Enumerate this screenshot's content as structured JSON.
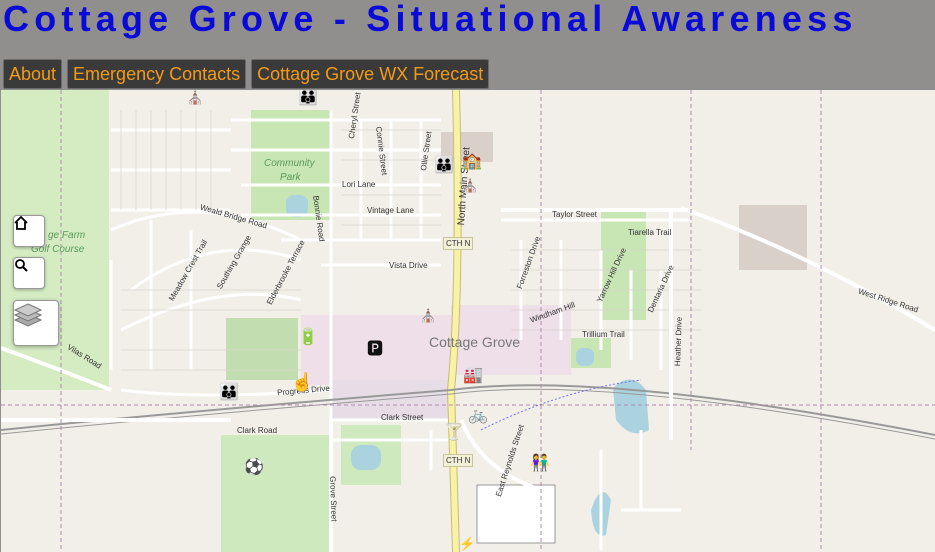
{
  "header": {
    "title": "Cottage Grove - Situational Awareness",
    "nav": [
      "About",
      "Emergency Contacts",
      "Cottage Grove WX Forecast"
    ]
  },
  "map": {
    "town_label": "Cottage Grove",
    "park_labels": [
      "Community",
      "Park",
      "ge Farm",
      "Golf Course"
    ],
    "streets": [
      "Cheryl Street",
      "Connie Street",
      "Ollie Street",
      "North Main Street",
      "Lori Lane",
      "Weald Bridge Road",
      "Bonnie Road",
      "Vintage Lane",
      "Taylor Street",
      "Tiarella Trail",
      "Meadow Crest Trail",
      "Southing Grange",
      "Elderbrooke Terrace",
      "Vista Drive",
      "Forreston Drive",
      "Windham Hill",
      "Yarrow Hill Drive",
      "Dentaria Drive",
      "West Ridge Road",
      "Trillium Trail",
      "Heather Drive",
      "Vilas Road",
      "Progress Drive",
      "Clark Street",
      "Clark Road",
      "Grove Street",
      "East Reynolds Street"
    ],
    "route_shields": [
      "CTH N",
      "CTH N"
    ],
    "controls": {
      "home": "home-icon",
      "search": "search-icon",
      "layers": "layers-icon"
    },
    "colors": {
      "title": "#0a0ad8",
      "nav_text": "#f39a16",
      "nav_bg": "#3a3a3a",
      "header_bg": "#918e8e",
      "map_bg": "#f2efe9",
      "park": "#c8e6b4",
      "main_road": "#f8f3a4"
    }
  }
}
